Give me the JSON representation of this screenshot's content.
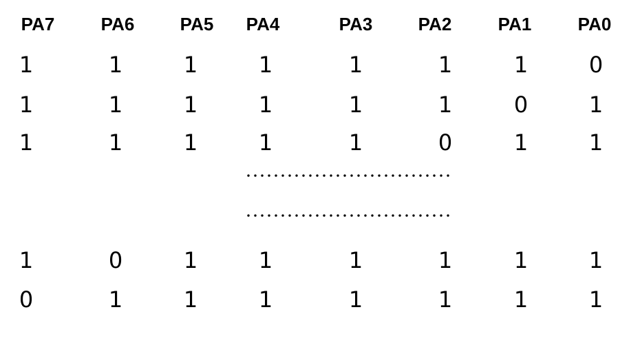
{
  "header": [
    "PA7",
    "PA6",
    "PA5",
    "PA4",
    "PA3",
    "PA2",
    "PA1",
    "PA0"
  ],
  "rows_top": [
    [
      "1",
      "1",
      "1",
      "1",
      "1",
      "1",
      "1",
      "0"
    ],
    [
      "1",
      "1",
      "1",
      "1",
      "1",
      "1",
      "0",
      "1"
    ],
    [
      "1",
      "1",
      "1",
      "1",
      "1",
      "0",
      "1",
      "1"
    ]
  ],
  "rows_bottom": [
    [
      "1",
      "0",
      "1",
      "1",
      "1",
      "1",
      "1",
      "1"
    ],
    [
      "0",
      "1",
      "1",
      "1",
      "1",
      "1",
      "1",
      "1"
    ]
  ]
}
